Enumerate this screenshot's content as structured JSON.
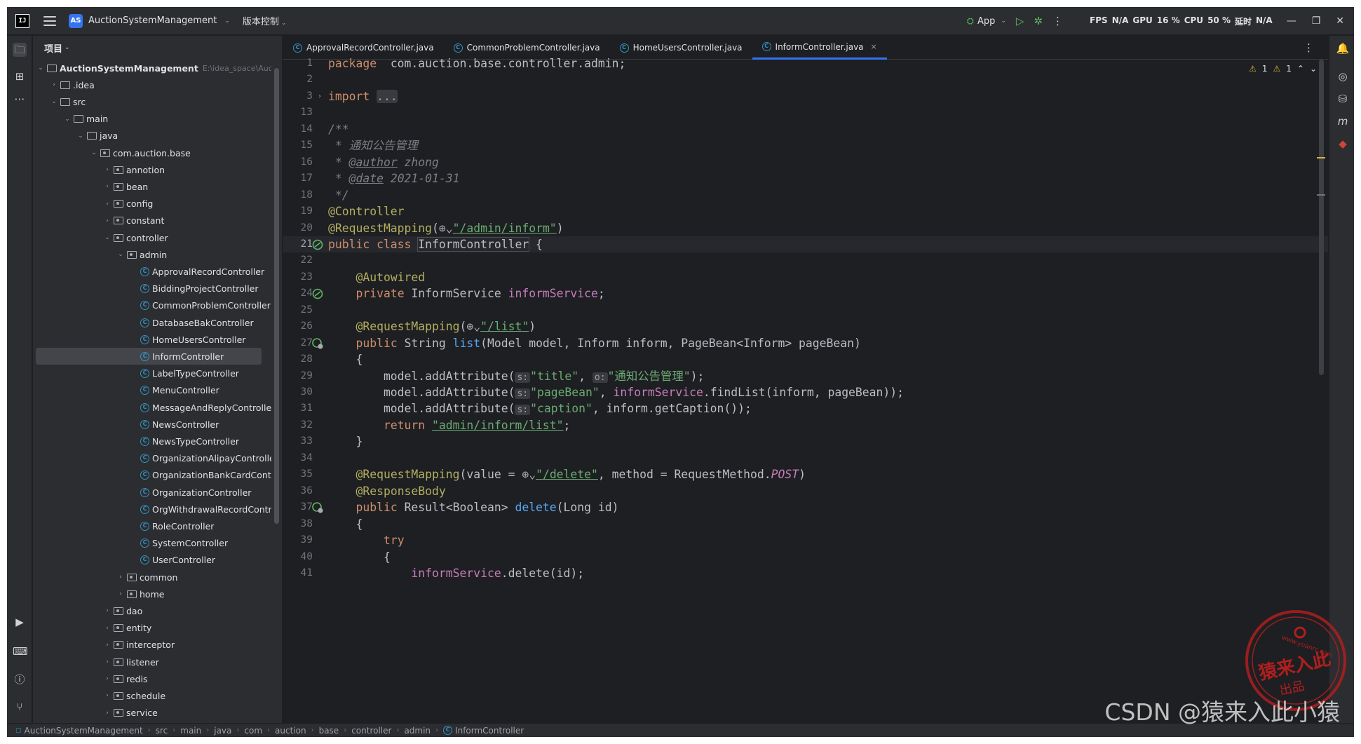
{
  "titlebar": {
    "logo": "IJ",
    "project_badge": "AS",
    "project_name": "AuctionSystemManagement",
    "vcs_label": "版本控制",
    "run_config": "App",
    "stats": [
      "FPS",
      "N/A",
      "GPU",
      "16 %",
      "CPU",
      "50 %",
      "延时",
      "N/A"
    ]
  },
  "project_panel": {
    "title": "项目",
    "root_name": "AuctionSystemManagement",
    "root_path": "E:\\idea_space\\Aucti",
    "tree": [
      {
        "label": ".idea",
        "depth": 1,
        "kind": "folder",
        "open": false
      },
      {
        "label": "src",
        "depth": 1,
        "kind": "folder",
        "open": true
      },
      {
        "label": "main",
        "depth": 2,
        "kind": "folder",
        "open": true
      },
      {
        "label": "java",
        "depth": 3,
        "kind": "folder",
        "open": true
      },
      {
        "label": "com.auction.base",
        "depth": 4,
        "kind": "pkg",
        "open": true
      },
      {
        "label": "annotion",
        "depth": 5,
        "kind": "pkg",
        "open": false
      },
      {
        "label": "bean",
        "depth": 5,
        "kind": "pkg",
        "open": false
      },
      {
        "label": "config",
        "depth": 5,
        "kind": "pkg",
        "open": false
      },
      {
        "label": "constant",
        "depth": 5,
        "kind": "pkg",
        "open": false
      },
      {
        "label": "controller",
        "depth": 5,
        "kind": "pkg",
        "open": true
      },
      {
        "label": "admin",
        "depth": 6,
        "kind": "pkg",
        "open": true
      },
      {
        "label": "ApprovalRecordController",
        "depth": 7,
        "kind": "class"
      },
      {
        "label": "BiddingProjectController",
        "depth": 7,
        "kind": "class"
      },
      {
        "label": "CommonProblemController",
        "depth": 7,
        "kind": "class"
      },
      {
        "label": "DatabaseBakController",
        "depth": 7,
        "kind": "class"
      },
      {
        "label": "HomeUsersController",
        "depth": 7,
        "kind": "class"
      },
      {
        "label": "InformController",
        "depth": 7,
        "kind": "class",
        "selected": true
      },
      {
        "label": "LabelTypeController",
        "depth": 7,
        "kind": "class"
      },
      {
        "label": "MenuController",
        "depth": 7,
        "kind": "class"
      },
      {
        "label": "MessageAndReplyController",
        "depth": 7,
        "kind": "class"
      },
      {
        "label": "NewsController",
        "depth": 7,
        "kind": "class"
      },
      {
        "label": "NewsTypeController",
        "depth": 7,
        "kind": "class"
      },
      {
        "label": "OrganizationAlipayController",
        "depth": 7,
        "kind": "class"
      },
      {
        "label": "OrganizationBankCardController",
        "depth": 7,
        "kind": "class"
      },
      {
        "label": "OrganizationController",
        "depth": 7,
        "kind": "class"
      },
      {
        "label": "OrgWithdrawalRecordController",
        "depth": 7,
        "kind": "class"
      },
      {
        "label": "RoleController",
        "depth": 7,
        "kind": "class"
      },
      {
        "label": "SystemController",
        "depth": 7,
        "kind": "class"
      },
      {
        "label": "UserController",
        "depth": 7,
        "kind": "class"
      },
      {
        "label": "common",
        "depth": 6,
        "kind": "pkg",
        "open": false
      },
      {
        "label": "home",
        "depth": 6,
        "kind": "pkg",
        "open": false
      },
      {
        "label": "dao",
        "depth": 5,
        "kind": "pkg",
        "open": false
      },
      {
        "label": "entity",
        "depth": 5,
        "kind": "pkg",
        "open": false
      },
      {
        "label": "interceptor",
        "depth": 5,
        "kind": "pkg",
        "open": false
      },
      {
        "label": "listener",
        "depth": 5,
        "kind": "pkg",
        "open": false
      },
      {
        "label": "redis",
        "depth": 5,
        "kind": "pkg",
        "open": false
      },
      {
        "label": "schedule",
        "depth": 5,
        "kind": "pkg",
        "open": false
      },
      {
        "label": "service",
        "depth": 5,
        "kind": "pkg",
        "open": false
      }
    ]
  },
  "editor": {
    "tabs": [
      {
        "label": "ApprovalRecordController.java",
        "active": false
      },
      {
        "label": "CommonProblemController.java",
        "active": false
      },
      {
        "label": "HomeUsersController.java",
        "active": false
      },
      {
        "label": "InformController.java",
        "active": true
      }
    ],
    "inspections": {
      "warnings_a": "1",
      "warnings_b": "1"
    },
    "current_line": 21,
    "lines": [
      {
        "n": 1,
        "segs": [
          [
            "kw",
            "package"
          ],
          [
            "",
            "  com.auction.base.controller.admin;"
          ]
        ]
      },
      {
        "n": 2,
        "segs": []
      },
      {
        "n": 3,
        "fold": true,
        "segs": [
          [
            "kw",
            "import"
          ],
          [
            "",
            " "
          ],
          [
            "foldbox",
            "..."
          ]
        ]
      },
      {
        "n": 13,
        "segs": []
      },
      {
        "n": 14,
        "segs": [
          [
            "cmt",
            "/**"
          ]
        ]
      },
      {
        "n": 15,
        "segs": [
          [
            "cmt",
            " * 通知公告管理"
          ]
        ]
      },
      {
        "n": 16,
        "segs": [
          [
            "cmt",
            " * "
          ],
          [
            "tag",
            "@author"
          ],
          [
            "cmt",
            " zhong"
          ]
        ]
      },
      {
        "n": 17,
        "segs": [
          [
            "cmt",
            " * "
          ],
          [
            "tag",
            "@date"
          ],
          [
            "cmt",
            " 2021-01-31"
          ]
        ]
      },
      {
        "n": 18,
        "segs": [
          [
            "cmt",
            " */"
          ]
        ]
      },
      {
        "n": 19,
        "segs": [
          [
            "ann",
            "@Controller"
          ]
        ]
      },
      {
        "n": 20,
        "segs": [
          [
            "ann",
            "@RequestMapping"
          ],
          [
            "",
            "("
          ],
          [
            "globe",
            "⊕⌄"
          ],
          [
            "strl",
            "\"/admin/inform\""
          ],
          [
            "",
            ")"
          ]
        ]
      },
      {
        "n": 21,
        "gut": "bean",
        "segs": [
          [
            "kw",
            "public class "
          ],
          [
            "ident",
            "InformController"
          ],
          [
            "",
            " {"
          ]
        ]
      },
      {
        "n": 22,
        "segs": []
      },
      {
        "n": 23,
        "segs": [
          [
            "",
            "    "
          ],
          [
            "ann",
            "@Autowired"
          ]
        ]
      },
      {
        "n": 24,
        "gut": "bean",
        "segs": [
          [
            "",
            "    "
          ],
          [
            "kw",
            "private "
          ],
          [
            "",
            "InformService "
          ],
          [
            "fld",
            "informService"
          ],
          [
            "",
            ";"
          ]
        ]
      },
      {
        "n": 25,
        "segs": []
      },
      {
        "n": 26,
        "segs": [
          [
            "",
            "    "
          ],
          [
            "ann",
            "@RequestMapping"
          ],
          [
            "",
            "("
          ],
          [
            "globe",
            "⊕⌄"
          ],
          [
            "strl",
            "\"/list\""
          ],
          [
            "",
            ")"
          ]
        ]
      },
      {
        "n": 27,
        "gut": "web",
        "segs": [
          [
            "",
            "    "
          ],
          [
            "kw",
            "public "
          ],
          [
            "",
            "String "
          ],
          [
            "mth",
            "list"
          ],
          [
            "",
            "(Model model, Inform inform, PageBean<Inform> pageBean)"
          ]
        ]
      },
      {
        "n": 28,
        "segs": [
          [
            "",
            "    {"
          ]
        ]
      },
      {
        "n": 29,
        "segs": [
          [
            "",
            "        model.addAttribute("
          ],
          [
            "hint",
            "s:"
          ],
          [
            "str",
            "\"title\""
          ],
          [
            "",
            ", "
          ],
          [
            "hint",
            "o:"
          ],
          [
            "str",
            "\"通知公告管理\""
          ],
          [
            "",
            ");"
          ]
        ]
      },
      {
        "n": 30,
        "segs": [
          [
            "",
            "        model.addAttribute("
          ],
          [
            "hint",
            "s:"
          ],
          [
            "str",
            "\"pageBean\""
          ],
          [
            "",
            ", "
          ],
          [
            "fld",
            "informService"
          ],
          [
            "",
            ".findList(inform, pageBean));"
          ]
        ]
      },
      {
        "n": 31,
        "segs": [
          [
            "",
            "        model.addAttribute("
          ],
          [
            "hint",
            "s:"
          ],
          [
            "str",
            "\"caption\""
          ],
          [
            "",
            ", inform.getCaption());"
          ]
        ]
      },
      {
        "n": 32,
        "segs": [
          [
            "",
            "        "
          ],
          [
            "kw",
            "return "
          ],
          [
            "strl",
            "\"admin/inform/list\""
          ],
          [
            "",
            ";"
          ]
        ]
      },
      {
        "n": 33,
        "segs": [
          [
            "",
            "    }"
          ]
        ]
      },
      {
        "n": 34,
        "segs": []
      },
      {
        "n": 35,
        "segs": [
          [
            "",
            "    "
          ],
          [
            "ann",
            "@RequestMapping"
          ],
          [
            "",
            "(value = "
          ],
          [
            "globe",
            "⊕⌄"
          ],
          [
            "strl",
            "\"/delete\""
          ],
          [
            "",
            ", method = RequestMethod."
          ],
          [
            "cst",
            "POST"
          ],
          [
            "",
            ")"
          ]
        ]
      },
      {
        "n": 36,
        "segs": [
          [
            "",
            "    "
          ],
          [
            "ann",
            "@ResponseBody"
          ]
        ]
      },
      {
        "n": 37,
        "gut": "web",
        "segs": [
          [
            "",
            "    "
          ],
          [
            "kw",
            "public "
          ],
          [
            "",
            "Result<Boolean> "
          ],
          [
            "mth",
            "delete"
          ],
          [
            "",
            "(Long id)"
          ]
        ]
      },
      {
        "n": 38,
        "segs": [
          [
            "",
            "    {"
          ]
        ]
      },
      {
        "n": 39,
        "segs": [
          [
            "",
            "        "
          ],
          [
            "kw",
            "try"
          ]
        ]
      },
      {
        "n": 40,
        "segs": [
          [
            "",
            "        {"
          ]
        ]
      },
      {
        "n": 41,
        "segs": [
          [
            "",
            "            "
          ],
          [
            "fld",
            "informService"
          ],
          [
            "",
            ".delete(id);"
          ]
        ]
      }
    ]
  },
  "statusbar": {
    "crumbs": [
      "AuctionSystemManagement",
      "src",
      "main",
      "java",
      "com",
      "auction",
      "base",
      "controller",
      "admin",
      "InformController"
    ]
  },
  "watermark": {
    "csdn": "CSDN @猿来入此小猿",
    "seal_main": "猿来入此",
    "seal_sub": "出品",
    "seal_url": "www.yuanrc.com"
  }
}
